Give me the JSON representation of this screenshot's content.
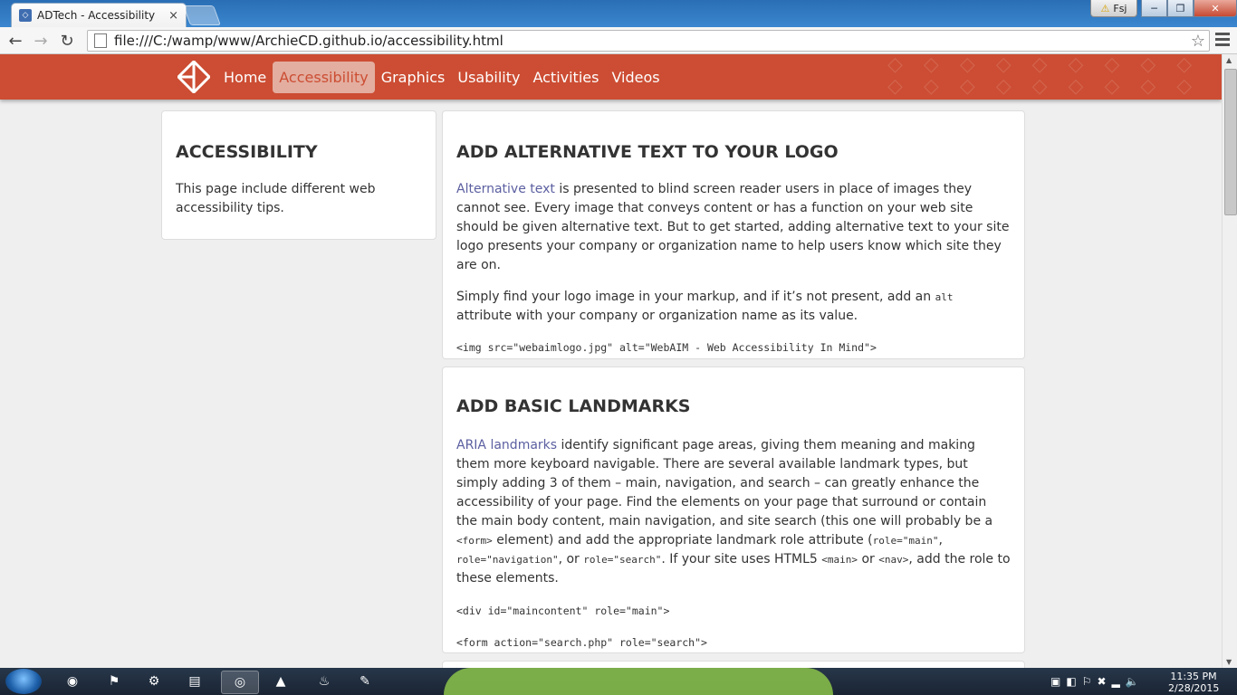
{
  "browser": {
    "tab_title": "ADTech - Accessibility",
    "tab_close": "×",
    "url": "file:///C:/wamp/www/ArchieCD.github.io/accessibility.html",
    "user_badge": "Fsj",
    "win_min": "─",
    "win_max": "❐",
    "win_close": "✕"
  },
  "nav": {
    "links": [
      "Home",
      "Accessibility",
      "Graphics",
      "Usability",
      "Activities",
      "Videos"
    ],
    "active_index": 1
  },
  "sidebar": {
    "title": "ACCESSIBILITY",
    "text": "This page include different web accessibility tips."
  },
  "sections": [
    {
      "title": "ADD ALTERNATIVE TEXT TO YOUR LOGO",
      "link_text": "Alternative text",
      "p1_rest": " is presented to blind screen reader users in place of images they cannot see. Every image that conveys content or has a function on your web site should be given alternative text. But to get started, adding alternative text to your site logo presents your company or organization name to help users know which site they are on.",
      "p2_a": "Simply find your logo image in your markup, and if it’s not present, add an ",
      "p2_code": "alt",
      "p2_b": " attribute with your company or organization name as its value.",
      "code": "<img src=\"webaimlogo.jpg\" alt=\"WebAIM - Web Accessibility In Mind\">"
    },
    {
      "title": "ADD BASIC LANDMARKS",
      "link_text": "ARIA landmarks",
      "p1_a": " identify significant page areas, giving them meaning and making them more keyboard navigable. There are several available landmark types, but simply adding 3 of them – main, navigation, and search – can greatly enhance the accessibility of your page. Find the elements on your page that surround or contain the main body content, main navigation, and site search (this one will probably be a ",
      "code_form": "<form>",
      "p1_b": " element) and add the appropriate landmark role attribute (",
      "code_main": "role=\"main\"",
      "sep1": ", ",
      "code_nav": "role=\"navigation\"",
      "sep2": ", or ",
      "code_search": "role=\"search\"",
      "p1_c": ". If your site uses HTML5 ",
      "code_main_tag": "<main>",
      "or": " or ",
      "code_nav_tag": "<nav>",
      "p1_d": ", add the role to these elements.",
      "code1": "<div id=\"maincontent\" role=\"main\">",
      "code2": "<form action=\"search.php\" role=\"search\">"
    }
  ],
  "taskbar": {
    "time": "11:35 PM",
    "date": "2/28/2015"
  },
  "colors": {
    "brand": "#cc4d33",
    "link": "#5b5fa0"
  }
}
